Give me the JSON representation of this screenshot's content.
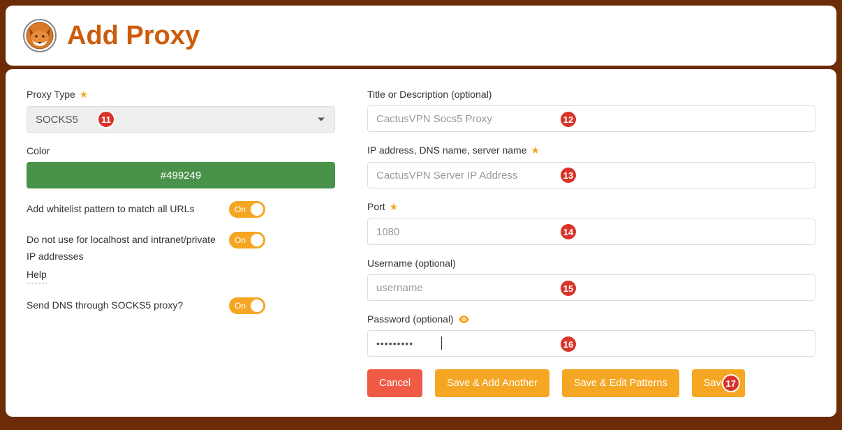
{
  "header": {
    "title": "Add Proxy"
  },
  "left": {
    "proxy_type_label": "Proxy Type",
    "proxy_type_value": "SOCKS5",
    "color_label": "Color",
    "color_value": "#499249",
    "whitelist_label": "Add whitelist pattern to match all URLs",
    "localhost_label": "Do not use for localhost and intranet/private IP addresses",
    "help_label": "Help",
    "dns_label": "Send DNS through SOCKS5 proxy?",
    "toggle_on": "On"
  },
  "right": {
    "title_label": "Title or Description (optional)",
    "title_placeholder": "CactusVPN Socs5 Proxy",
    "ip_label": "IP address, DNS name, server name",
    "ip_placeholder": "CactusVPN Server IP Address",
    "port_label": "Port",
    "port_placeholder": "1080",
    "username_label": "Username (optional)",
    "username_placeholder": "username",
    "password_label": "Password (optional)",
    "password_value": "•••••••••"
  },
  "buttons": {
    "cancel": "Cancel",
    "save_add": "Save & Add Another",
    "save_edit": "Save & Edit Patterns",
    "save": "Save"
  },
  "badges": {
    "b11": "11",
    "b12": "12",
    "b13": "13",
    "b14": "14",
    "b15": "15",
    "b16": "16",
    "b17": "17"
  }
}
